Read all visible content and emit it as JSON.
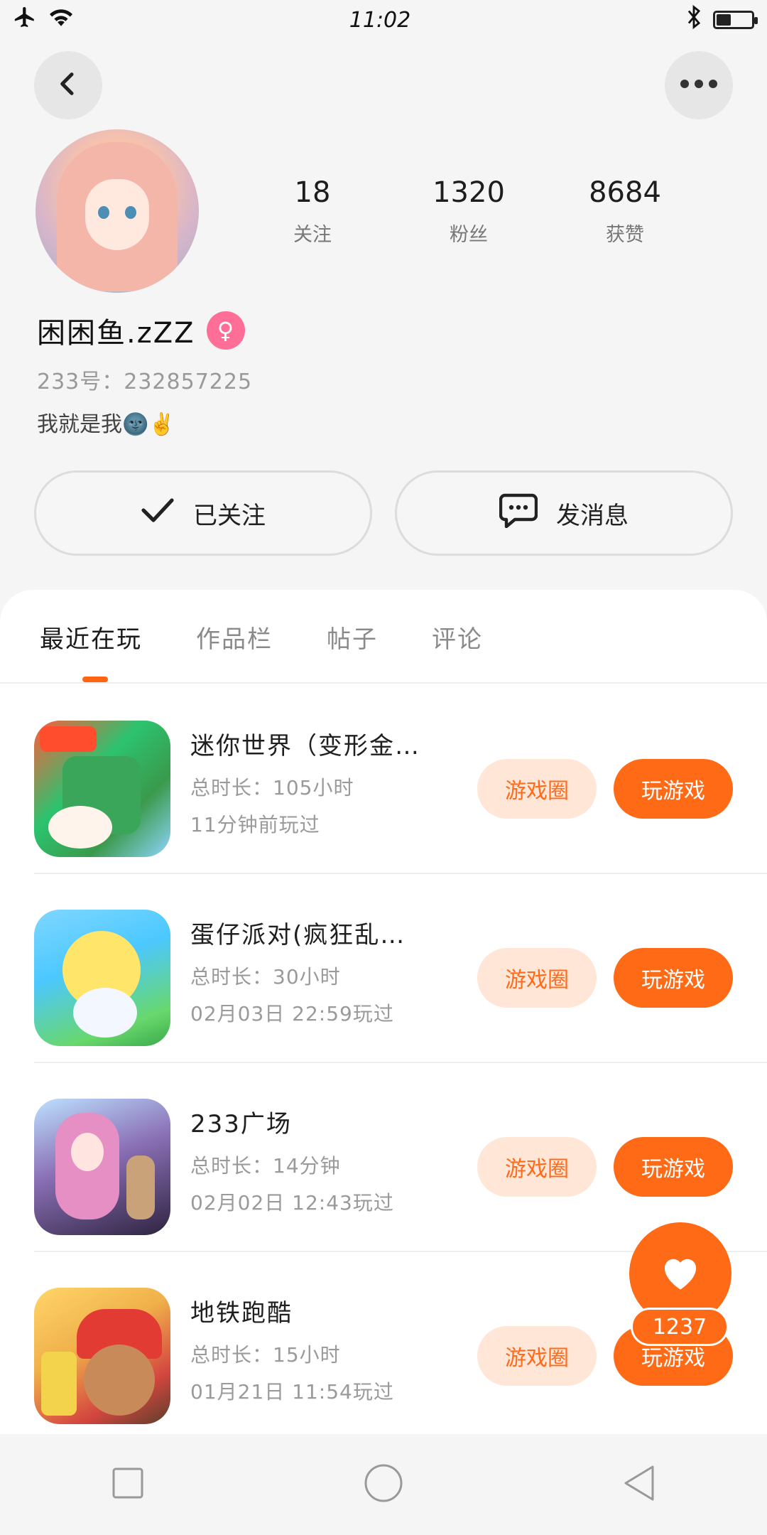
{
  "status_bar": {
    "time": "11:02"
  },
  "header": {
    "back_icon": "chevron-left-icon",
    "more_icon": "more-dots-icon"
  },
  "profile": {
    "username": "困困鱼.zZZ",
    "gender_icon": "female-icon",
    "user_id": "233号：232857225",
    "signature": "我就是我🌚✌️",
    "stats": [
      {
        "value": "18",
        "label": "关注"
      },
      {
        "value": "1320",
        "label": "粉丝"
      },
      {
        "value": "8684",
        "label": "获赞"
      }
    ],
    "follow_label": "已关注",
    "message_label": "发消息"
  },
  "tabs": [
    {
      "label": "最近在玩",
      "active": true
    },
    {
      "label": "作品栏",
      "active": false
    },
    {
      "label": "帖子",
      "active": false
    },
    {
      "label": "评论",
      "active": false
    }
  ],
  "games": [
    {
      "title": "迷你世界（变形金…",
      "duration": "总时长：105小时",
      "last_played": "11分钟前玩过",
      "circle_label": "游戏圈",
      "play_label": "玩游戏"
    },
    {
      "title": "蛋仔派对(疯狂乱…",
      "duration": "总时长：30小时",
      "last_played": "02月03日 22:59玩过",
      "circle_label": "游戏圈",
      "play_label": "玩游戏"
    },
    {
      "title": "233广场",
      "duration": "总时长：14分钟",
      "last_played": "02月02日 12:43玩过",
      "circle_label": "游戏圈",
      "play_label": "玩游戏"
    },
    {
      "title": "地铁跑酷",
      "duration": "总时长：15小时",
      "last_played": "01月21日 11:54玩过",
      "circle_label": "游戏圈",
      "play_label": "玩游戏"
    }
  ],
  "like": {
    "count": "1237",
    "icon": "heart-icon"
  },
  "colors": {
    "accent": "#ff6a17",
    "accent_light": "#ffe6d7",
    "female": "#ff6e96"
  }
}
